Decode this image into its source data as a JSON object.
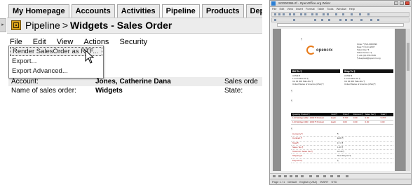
{
  "tabs": [
    "My Homepage",
    "Accounts",
    "Activities",
    "Pipeline",
    "Products",
    "Depots",
    "»"
  ],
  "breadcrumb": {
    "parent": "Pipeline",
    "separator": ">",
    "current": "Widgets - Sales Order"
  },
  "menu": [
    "File",
    "Edit",
    "View",
    "Actions",
    "Security"
  ],
  "dropdown": [
    "Render SalesOrder as RTF...",
    "Export...",
    "Export Advanced..."
  ],
  "fields": [
    {
      "label": "Account:",
      "value": "Jones, Catherine Dana",
      "label2": "Sales orde"
    },
    {
      "label": "Name of sales order:",
      "value": "Widgets",
      "label2": "State:"
    }
  ],
  "writer": {
    "title": "SO000396.rtf - OpenOffice.org Writer",
    "menu": [
      "File",
      "Edit",
      "View",
      "Insert",
      "Format",
      "Table",
      "Tools",
      "Window",
      "Help"
    ],
    "status": [
      "Page 1 / 1",
      "Default",
      "English (USA)",
      "INSRT",
      "STD"
    ],
    "page": {
      "logo_text": "opencrx",
      "header_lines": [
        "Order: ¶  SO-0000396",
        "Date: ¶  31.01.2007",
        "Sales Rep: ¶",
        "Sales Person: ¶",
        "¶  +41 (0)1 555 5555",
        "¶  deeplook@opencrx.org"
      ],
      "bill_to": "Bill To ¶",
      "ship_to": "Ship To ¶",
      "bill_lines": [
        "ACME ¶",
        "1 Innovation Dr ¶",
        "CA 94 000 Palo Alto ¶",
        "United States of America (USA) ¶"
      ],
      "ship_lines": [
        "ACME ¶",
        "1 Innovation Dr ¶",
        "CA 94 000 Palo Alto ¶",
        "United States of America (USA) ¶"
      ],
      "table_head": [
        "Quantity Product ¶",
        "UoM ¶",
        "Price ¶",
        "Discount ¶",
        "Sales Tax ¶",
        "Total ¶"
      ],
      "table_rows": [
        [
          "1.00 Widget (00) / 1000 ¶ Product",
          "Each",
          "5.707",
          "0.00",
          "0.00",
          "5.707"
        ],
        [
          "1.00 Widget (00) / 1000 ¶ Product",
          "Each",
          "0.00",
          "0.00",
          "0.00",
          "0.00"
        ]
      ],
      "summary": [
        [
          "Currency ¶",
          "¶"
        ],
        [
          "Contract ¶",
          "EUR ¶"
        ],
        [
          "Total ¶",
          "17.1 ¶"
        ],
        [
          "Sales Tax ¶",
          "1.29 ¶"
        ],
        [
          "Total Incl. Sales Tax ¶",
          "18.40 ¶"
        ],
        [
          "Shipping ¶",
          "Next Day Air ¶"
        ],
        [
          "Payment ¶",
          "¶"
        ]
      ]
    }
  }
}
